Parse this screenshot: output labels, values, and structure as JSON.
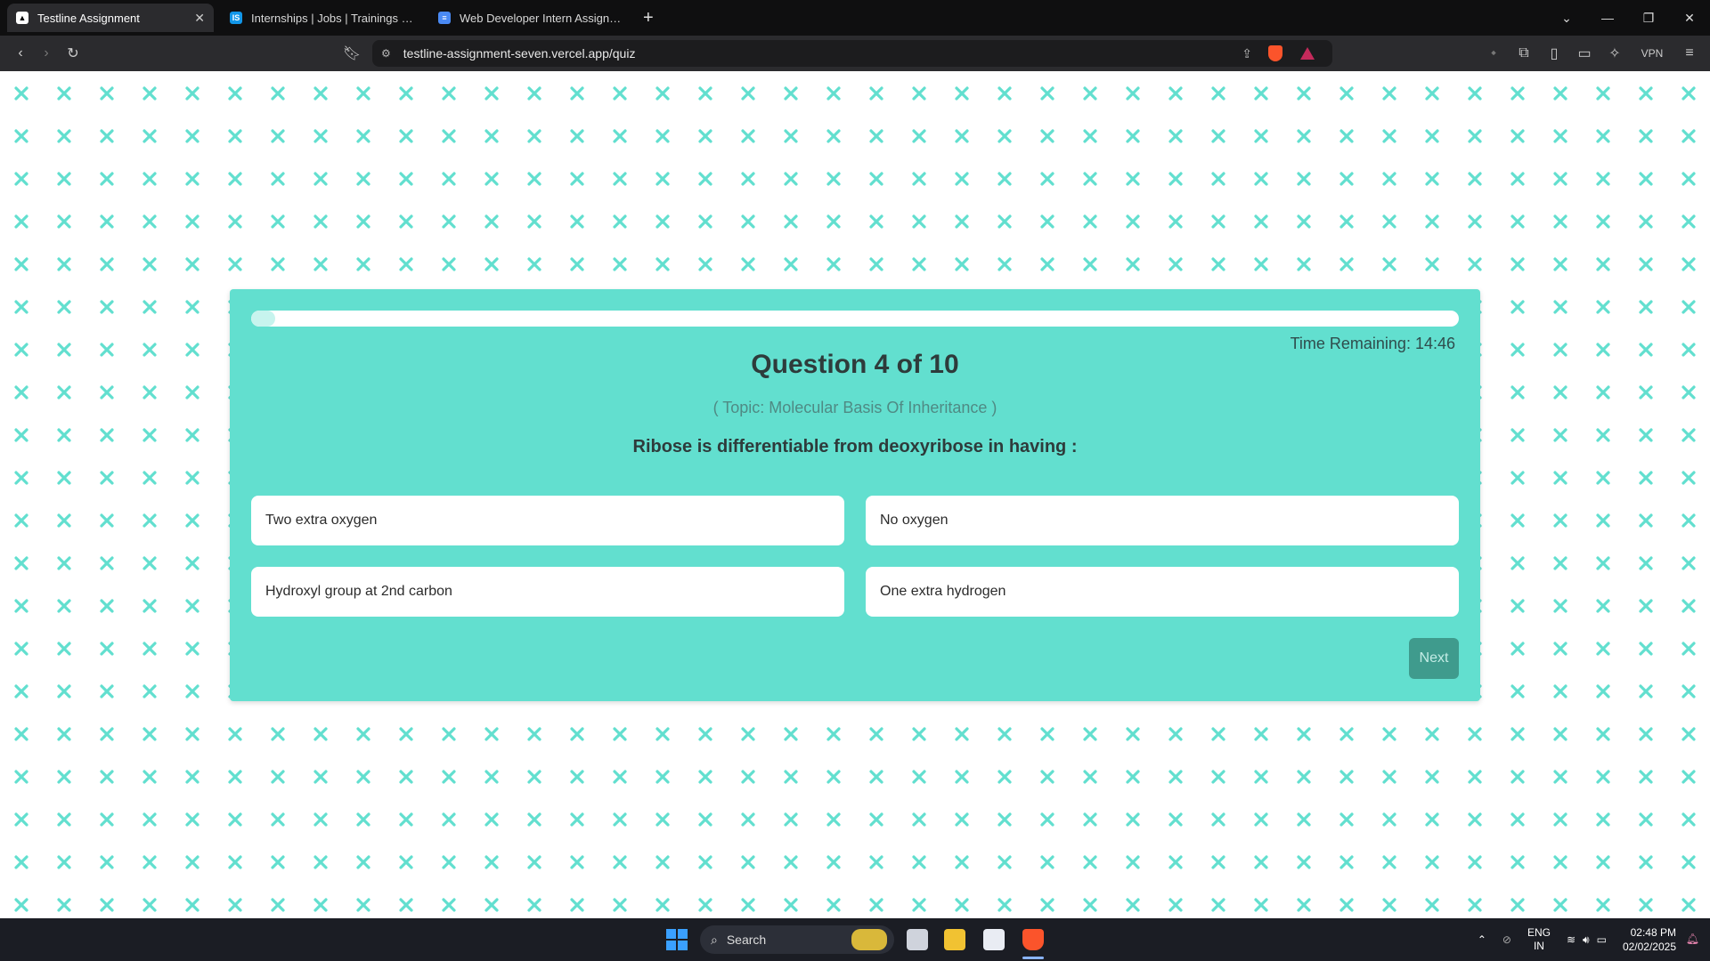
{
  "tabs": [
    {
      "label": "Testline Assignment",
      "active": true
    },
    {
      "label": "Internships | Jobs | Trainings & Placements",
      "active": false
    },
    {
      "label": "Web Developer Intern Assignment",
      "active": false
    }
  ],
  "browser": {
    "url": "testline-assignment-seven.vercel.app/quiz",
    "vpn_label": "VPN"
  },
  "quiz": {
    "time_remaining": "Time Remaining: 14:46",
    "question_title": "Question 4 of 10",
    "topic": "( Topic: Molecular Basis Of Inheritance )",
    "question_text": "Ribose is differentiable from deoxyribose in having :",
    "progress_fraction": 0.02,
    "options": [
      "Two extra oxygen",
      "No oxygen",
      "Hydroxyl group at 2nd carbon",
      "One extra hydrogen"
    ],
    "next_label": "Next"
  },
  "taskbar": {
    "search_label": "Search",
    "lang_top": "ENG",
    "lang_bottom": "IN",
    "time": "02:48 PM",
    "date": "02/02/2025"
  },
  "colors": {
    "card": "#62dfcf",
    "pattern": "#62dfcf",
    "next_button": "#3f9b8d"
  }
}
